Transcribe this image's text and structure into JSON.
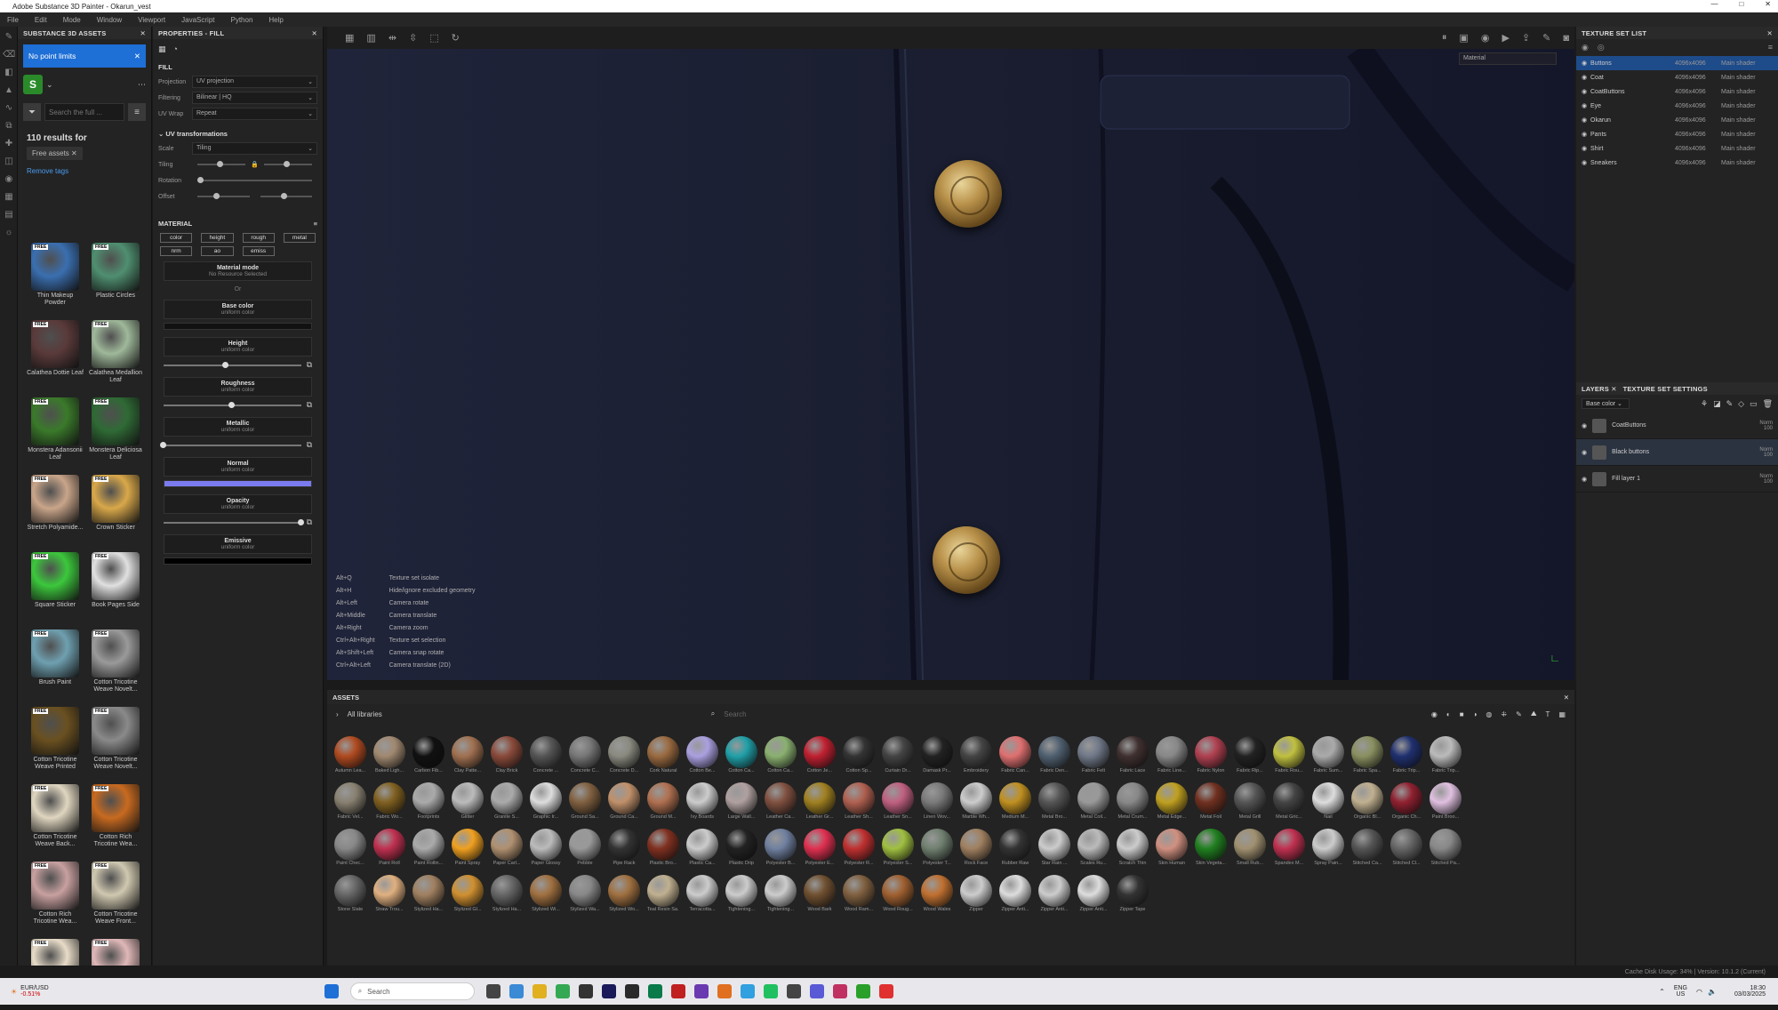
{
  "app": {
    "title": "Adobe Substance 3D Painter - Okarun_vest",
    "window_controls": [
      "—",
      "□",
      "✕"
    ]
  },
  "menu": [
    "File",
    "Edit",
    "Mode",
    "Window",
    "Viewport",
    "JavaScript",
    "Python",
    "Help"
  ],
  "assets_panel": {
    "header": "SUBSTANCE 3D ASSETS",
    "banner": "No point limits",
    "search_placeholder": "Search the full ...",
    "results_text": "110 results for",
    "tag": "Free assets",
    "remove_tags": "Remove tags",
    "items": [
      {
        "label": "Thin Makeup Powder",
        "color": "#3a6fb0",
        "badge": "FREE"
      },
      {
        "label": "Plastic Circles",
        "color": "#4f8f70",
        "badge": "FREE"
      },
      {
        "label": "Calathea Dottie Leaf",
        "color": "#5a3a3a",
        "badge": "FREE"
      },
      {
        "label": "Calathea Medallion Leaf",
        "color": "#9fb89a",
        "badge": "FREE"
      },
      {
        "label": "Monstera Adansonii Leaf",
        "color": "#3a7a2a",
        "badge": "FREE"
      },
      {
        "label": "Monstera Deliciosa Leaf",
        "color": "#2f6a35",
        "badge": "FREE"
      },
      {
        "label": "Stretch Polyamide...",
        "color": "#c9a58a",
        "badge": "FREE"
      },
      {
        "label": "Crown Sticker",
        "color": "#d9a84a",
        "badge": "FREE"
      },
      {
        "label": "Square Sticker",
        "color": "#3cc83c",
        "badge": "FREE"
      },
      {
        "label": "Book Pages Side",
        "color": "#e0e0e0",
        "badge": "FREE"
      },
      {
        "label": "Brush Paint",
        "color": "#6fa0b0",
        "badge": "FREE"
      },
      {
        "label": "Cotton Tricotine Weave Novelt...",
        "color": "#9a9a9a",
        "badge": "FREE"
      },
      {
        "label": "Cotton Tricotine Weave Printed",
        "color": "#6a5020",
        "badge": "FREE"
      },
      {
        "label": "Cotton Tricotine Weave Novelt...",
        "color": "#8a8a8a",
        "badge": "FREE"
      },
      {
        "label": "Cotton Tricotine Weave Back...",
        "color": "#e0d6c0",
        "badge": "FREE"
      },
      {
        "label": "Cotton Rich Tricotine Wea...",
        "color": "#c86a20",
        "badge": "FREE"
      },
      {
        "label": "Cotton Rich Tricotine Wea...",
        "color": "#c8a0a0",
        "badge": "FREE"
      },
      {
        "label": "Cotton Tricotine Weave Front...",
        "color": "#d0c8b0",
        "badge": "FREE"
      },
      {
        "label": "",
        "color": "#e8dcc8",
        "badge": "FREE"
      },
      {
        "label": "",
        "color": "#e0b8b8",
        "badge": "FREE"
      }
    ]
  },
  "properties": {
    "header": "PROPERTIES - FILL",
    "fill_label": "FILL",
    "projection_label": "Projection",
    "projection_value": "UV projection",
    "filtering_label": "Filtering",
    "filtering_value": "Bilinear | HQ",
    "uvwrap_label": "UV Wrap",
    "uvwrap_value": "Repeat",
    "uv_transform": "UV transformations",
    "scale_label": "Scale",
    "scale_value": "Tiling",
    "tiling_label": "Tiling",
    "rotation_label": "Rotation",
    "offset_label": "Offset",
    "material_label": "MATERIAL",
    "channels": [
      "color",
      "height",
      "rough",
      "metal",
      "nrm",
      "ao",
      "emiss"
    ],
    "material_mode": "Material mode",
    "material_mode_sub": "No Resource Selected",
    "or_text": "Or",
    "blocks": [
      {
        "title": "Base color",
        "sub": "uniform color",
        "bar": "#111111"
      },
      {
        "title": "Height",
        "sub": "uniform color",
        "slider": 0.45
      },
      {
        "title": "Roughness",
        "sub": "uniform color",
        "slider": 0.5
      },
      {
        "title": "Metallic",
        "sub": "uniform color",
        "slider": 0.0
      },
      {
        "title": "Normal",
        "sub": "uniform color",
        "bar": "#7b7bf0"
      },
      {
        "title": "Opacity",
        "sub": "uniform color",
        "slider": 1.0
      },
      {
        "title": "Emissive",
        "sub": "uniform color",
        "bar": "#000000"
      }
    ]
  },
  "viewport": {
    "mode": "Material",
    "hotkeys": [
      [
        "Alt+Q",
        "Texture set isolate"
      ],
      [
        "Alt+H",
        "Hide/ignore excluded geometry"
      ],
      [
        "Alt+Left",
        "Camera rotate"
      ],
      [
        "Alt+Middle",
        "Camera translate"
      ],
      [
        "Alt+Right",
        "Camera zoom"
      ],
      [
        "Ctrl+Alt+Right",
        "Texture set selection"
      ],
      [
        "Alt+Shift+Left",
        "Camera snap rotate"
      ],
      [
        "Ctrl+Alt+Left",
        "Camera translate (2D)"
      ]
    ]
  },
  "assets_bottom": {
    "header": "ASSETS",
    "library": "All libraries",
    "search_placeholder": "Search",
    "spheres": [
      [
        "Autumn Lea...",
        "#b04a20"
      ],
      [
        "Baked Ligh...",
        "#a08870"
      ],
      [
        "Carbon Fib...",
        "#111"
      ],
      [
        "Clay Patte...",
        "#a07050"
      ],
      [
        "Clay Brick",
        "#8a4a3a"
      ],
      [
        "Concrete ...",
        "#555"
      ],
      [
        "Concrete C...",
        "#777"
      ],
      [
        "Concrete D...",
        "#8a8a80"
      ],
      [
        "Cork Natural",
        "#9a6a40"
      ],
      [
        "Cotton Be...",
        "#aaa0e0"
      ],
      [
        "Cotton Ca...",
        "#20a0a8"
      ],
      [
        "Cotton Ca...",
        "#8ab070"
      ],
      [
        "Cotton Je...",
        "#c02030"
      ],
      [
        "Cotton Sp...",
        "#333"
      ],
      [
        "Curtain Dr...",
        "#444"
      ],
      [
        "Damask Pr...",
        "#222"
      ],
      [
        "Embroidery",
        "#444"
      ],
      [
        "Fabric Can...",
        "#e07070"
      ],
      [
        "Fabric Den...",
        "#506070"
      ],
      [
        "Fabric Felt",
        "#707888"
      ],
      [
        "Fabric Lace",
        "#403030"
      ],
      [
        "Fabric Line...",
        "#888"
      ],
      [
        "Fabric Nylon",
        "#b04050"
      ],
      [
        "Fabric Rip...",
        "#222"
      ],
      [
        "Fabric Rou...",
        "#c0c040"
      ],
      [
        "Fabric Sum...",
        "#aaa"
      ],
      [
        "Fabric Spa...",
        "#8a9060"
      ],
      [
        "Fabric Trip...",
        "#203070"
      ],
      [
        "Fabric Trip...",
        "#bbb"
      ],
      [
        "Fabric Vel...",
        "#888070"
      ],
      [
        "Fabric Wo...",
        "#806020"
      ],
      [
        "Footprints",
        "#aaa"
      ],
      [
        "Glitter",
        "#bbb"
      ],
      [
        "Granite S...",
        "#aaa"
      ],
      [
        "Graphic Ir...",
        "#ddd"
      ],
      [
        "Ground Sa...",
        "#806040"
      ],
      [
        "Ground Ca...",
        "#c0906a"
      ],
      [
        "Ground M...",
        "#b07050"
      ],
      [
        "Ivy Boards",
        "#ccc"
      ],
      [
        "Large Wall...",
        "#b0a0a0"
      ],
      [
        "Leather Ca...",
        "#805040"
      ],
      [
        "Leather Gr...",
        "#a08020"
      ],
      [
        "Leather Sh...",
        "#b06050"
      ],
      [
        "Leather Sn...",
        "#c06080"
      ],
      [
        "Linen Wov...",
        "#7a7a7a"
      ],
      [
        "Marble Wh...",
        "#ccc"
      ],
      [
        "Medium M...",
        "#c09020"
      ],
      [
        "Metal Bro...",
        "#555"
      ],
      [
        "Metal Coil...",
        "#999"
      ],
      [
        "Metal Crum...",
        "#888"
      ],
      [
        "Metal Edge...",
        "#c0a020"
      ],
      [
        "Metal Foil",
        "#703020"
      ],
      [
        "Metal Grill",
        "#555"
      ],
      [
        "Metal Gric...",
        "#444"
      ],
      [
        "Nail",
        "#ddd"
      ],
      [
        "Organic Bl...",
        "#c0b090"
      ],
      [
        "Organic Ch...",
        "#902030"
      ],
      [
        "Paint Broo...",
        "#e0c0e0"
      ],
      [
        "Paint Chec...",
        "#888"
      ],
      [
        "Paint Roll",
        "#c03050"
      ],
      [
        "Paint Rollin...",
        "#aaa"
      ],
      [
        "Paint Spray",
        "#f0a020"
      ],
      [
        "Paper Carl...",
        "#b09070"
      ],
      [
        "Paper Glossy",
        "#bbb"
      ],
      [
        "Pebble",
        "#999"
      ],
      [
        "Pipe Rack",
        "#333"
      ],
      [
        "Plastic Bro...",
        "#803020"
      ],
      [
        "Plastic Ca...",
        "#ccc"
      ],
      [
        "Plastic Drip",
        "#222"
      ],
      [
        "Polyester B...",
        "#7080a0"
      ],
      [
        "Polyester E...",
        "#e03050"
      ],
      [
        "Polyester R...",
        "#c03030"
      ],
      [
        "Polyester S...",
        "#a0c040"
      ],
      [
        "Polyester T...",
        "#708070"
      ],
      [
        "Rock Face",
        "#a08060"
      ],
      [
        "Rubber Raw",
        "#333"
      ],
      [
        "Star Rain ...",
        "#ccc"
      ],
      [
        "Scales Ru...",
        "#bbb"
      ],
      [
        "Scratch Thin",
        "#ccc"
      ],
      [
        "Skin Human",
        "#d09080"
      ],
      [
        "Skin Vegeta...",
        "#208020"
      ],
      [
        "Small Rub...",
        "#a09070"
      ],
      [
        "Spandex M...",
        "#c03050"
      ],
      [
        "Spray Pain...",
        "#ccc"
      ],
      [
        "Stitched Ca...",
        "#555"
      ],
      [
        "Stitched Cl...",
        "#666"
      ],
      [
        "Stitched Pa...",
        "#888"
      ],
      [
        "Stone Slate",
        "#666"
      ],
      [
        "Straw Trou...",
        "#e0b080"
      ],
      [
        "Stylized Ha...",
        "#a08060"
      ],
      [
        "Stylized Gl...",
        "#d09030"
      ],
      [
        "Stylized Ha...",
        "#666"
      ],
      [
        "Stylized Wi...",
        "#a07040"
      ],
      [
        "Stylized Wa...",
        "#888"
      ],
      [
        "Stylized Wo...",
        "#a07040"
      ],
      [
        "Teal Resin Sa...",
        "#c0b090"
      ],
      [
        "Terracotta...",
        "#ccc"
      ],
      [
        "Tightening...",
        "#ccc"
      ],
      [
        "Tightening...",
        "#ccc"
      ],
      [
        "Wood Bark",
        "#705030"
      ],
      [
        "Wood Ram...",
        "#806040"
      ],
      [
        "Wood Roug...",
        "#a06030"
      ],
      [
        "Wood Wales",
        "#c07030"
      ],
      [
        "Zipper",
        "#ccc"
      ],
      [
        "Zipper Anti...",
        "#ddd"
      ],
      [
        "Zipper Anti...",
        "#ccc"
      ],
      [
        "Zipper Anti...",
        "#ddd"
      ],
      [
        "Zipper Tape",
        "#333"
      ]
    ]
  },
  "texture_set_list": {
    "header": "TEXTURE SET LIST",
    "rows": [
      {
        "name": "Buttons",
        "res": "4096x4096",
        "shader": "Main shader",
        "selected": true
      },
      {
        "name": "Coat",
        "res": "4096x4096",
        "shader": "Main shader"
      },
      {
        "name": "CoatButtons",
        "res": "4096x4096",
        "shader": "Main shader"
      },
      {
        "name": "Eye",
        "res": "4096x4096",
        "shader": "Main shader"
      },
      {
        "name": "Okarun",
        "res": "4096x4096",
        "shader": "Main shader"
      },
      {
        "name": "Pants",
        "res": "4096x4096",
        "shader": "Main shader"
      },
      {
        "name": "Shirt",
        "res": "4096x4096",
        "shader": "Main shader"
      },
      {
        "name": "Sneakers",
        "res": "4096x4096",
        "shader": "Main shader"
      }
    ]
  },
  "layers": {
    "tab1": "LAYERS",
    "tab2": "TEXTURE SET SETTINGS",
    "channel": "Base color",
    "rows": [
      {
        "name": "CoatButtons",
        "blend": "Norm",
        "opacity": "100"
      },
      {
        "name": "Black buttons",
        "blend": "Norm",
        "opacity": "100"
      },
      {
        "name": "Fill layer 1",
        "blend": "Norm",
        "opacity": "100"
      }
    ]
  },
  "status": {
    "cache": "Cache Disk Usage: 34% | Version: 10.1.2 (Current)"
  },
  "taskbar": {
    "weather": "EUR/USD",
    "weather_sub": "-0.51%",
    "search": "Search",
    "lang": "ENG",
    "lang_sub": "US",
    "time": "18:30",
    "date": "03/03/2025"
  }
}
